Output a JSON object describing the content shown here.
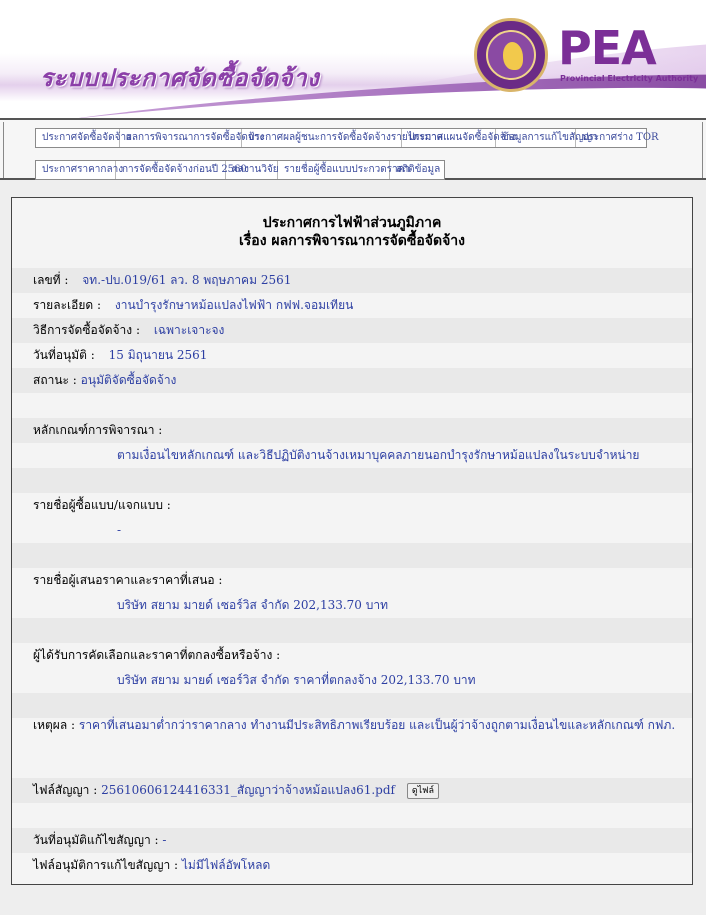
{
  "header": {
    "site_title": "ระบบประกาศจัดซื้อจัดจ้าง",
    "logo_text": "PEA",
    "logo_subtitle": "Provincial Electricity Authority",
    "seal_text": "การไฟฟ้าส่วนภูมิภาค"
  },
  "nav": {
    "row1": [
      "ประกาศจัดซื้อจัดจ้าง",
      "ผลการพิจารณาการจัดซื้อจัดจ้าง",
      "ประกาศผลผู้ชนะการจัดซื้อจัดจ้างรายไตรมาส",
      "ประกาศแผนจัดซื้อจัดจ้าง",
      "ข้อมูลการแก้ไขสัญญา",
      "ประกาศร่าง TOR"
    ],
    "row2": [
      "ประกาศราคากลาง",
      "การจัดซื้อจัดจ้างก่อนปี 2560",
      "ผลงานวิจัย",
      "รายชื่อผู้ซื้อแบบประกวดราคา",
      "สถิติข้อมูล"
    ]
  },
  "announcement": {
    "title_line1": "ประกาศการไฟฟ้าส่วนภูมิภาค",
    "title_line2": "เรื่อง ผลการพิจารณาการจัดซื้อจัดจ้าง",
    "number_label": "เลขที่ :",
    "number_value": "จท.-ปบ.019/61 ลว. 8 พฤษภาคม 2561",
    "detail_label": "รายละเอียด :",
    "detail_value": "งานบำรุงรักษาหม้อแปลงไฟฟ้า กฟฟ.จอมเทียน",
    "method_label": "วิธีการจัดซื้อจัดจ้าง :",
    "method_value": "เฉพาะเจาะจง",
    "approve_date_label": "วันที่อนุมัติ :",
    "approve_date_value": "15 มิถุนายน 2561",
    "status_label": "สถานะ :",
    "status_value": "อนุมัติจัดซื้อจัดจ้าง",
    "criteria_label": "หลักเกณฑ์การพิจารณา :",
    "criteria_value": "ตามเงื่อนไขหลักเกณฑ์ และวิธีปฏิบัติงานจ้างเหมาบุคคลภายนอกบำรุงรักษาหม้อแปลงในระบบจำหน่าย",
    "buyers_label": "รายชื่อผู้ซื้อแบบ/แจกแบบ :",
    "buyers_value": "-",
    "bidders_label": "รายชื่อผู้เสนอราคาและราคาที่เสนอ :",
    "bidders_value": "บริษัท สยาม มายด์ เซอร์วิส จำกัด 202,133.70 บาท",
    "winner_label": "ผู้ได้รับการคัดเลือกและราคาที่ตกลงซื้อหรือจ้าง :",
    "winner_value": "บริษัท สยาม มายด์ เซอร์วิส จำกัด ราคาที่ตกลงจ้าง 202,133.70 บาท",
    "reason_label": "เหตุผล :",
    "reason_value": "ราคาที่เสนอมาต่ำกว่าราคากลาง ทำงานมีประสิทธิภาพเรียบร้อย และเป็นผู้ว่าจ้างถูกตามเงื่อนไขและหลักเกณฑ์ กฟภ.",
    "contract_file_label": "ไฟล์สัญญา :",
    "contract_file_value": "25610606124416331_สัญญาว่าจ้างหม้อแปลง61.pdf",
    "view_file_button": "ดูไฟล์",
    "amend_date_label": "วันที่อนุมัติแก้ไขสัญญา :",
    "amend_date_value": "-",
    "amend_file_label": "ไฟล์อนุมัติการแก้ไขสัญญา :",
    "amend_file_value": "ไม่มีไฟล์อัพโหลด"
  }
}
